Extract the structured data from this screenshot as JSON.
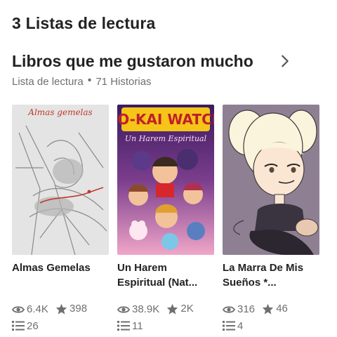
{
  "section": {
    "title": "3 Listas de lectura"
  },
  "reading_list": {
    "title": "Libros que me gustaron mucho",
    "type_label": "Lista de lectura",
    "count_label": "71 Historias"
  },
  "books": [
    {
      "title": "Almas Gemelas",
      "cover_text": "Almas gemelas",
      "reads": "6.4K",
      "votes": "398",
      "parts": "26"
    },
    {
      "title": "Un Harem Espiritual (Nat...",
      "cover_text": "YO-KAI WATCH",
      "cover_subtitle": "Un Harem Espiritual",
      "reads": "38.9K",
      "votes": "2K",
      "parts": "11"
    },
    {
      "title": "La Marra De Mis Sueños *...",
      "reads": "316",
      "votes": "46",
      "parts": "4"
    }
  ],
  "colors": {
    "text_primary": "#222222",
    "text_secondary": "#6f6f6f",
    "background": "#ffffff"
  }
}
